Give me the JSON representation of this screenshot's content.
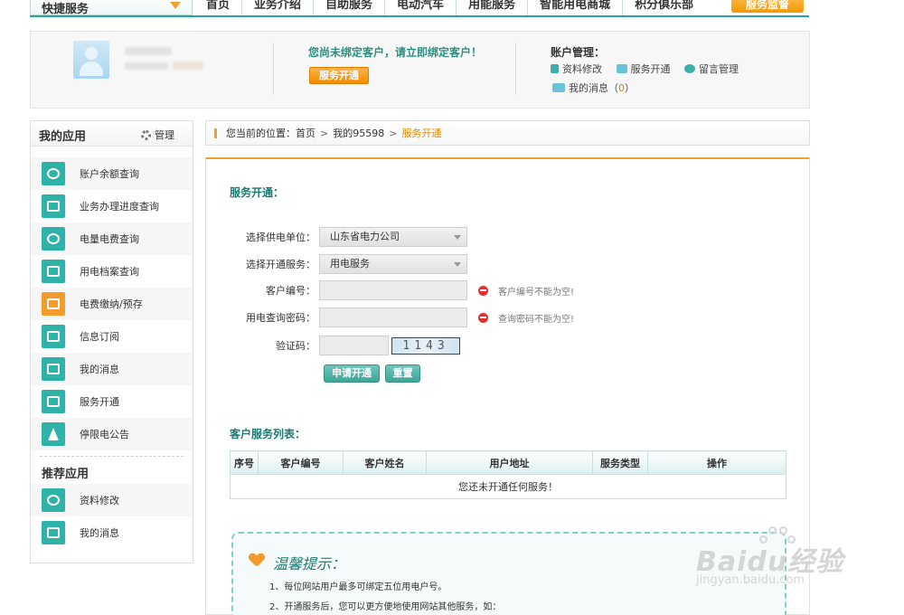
{
  "topnav": {
    "quick_label": "快捷服务",
    "items": [
      "首页",
      "业务介绍",
      "自助服务",
      "电动汽车",
      "用能服务",
      "智能用电商城",
      "积分俱乐部"
    ],
    "supervise_label": "服务监督"
  },
  "account": {
    "bind_message": "您尚未绑定客户，请立即绑定客户！",
    "bind_button": "服务开通",
    "manage_title": "账户管理：",
    "links": [
      "资料修改",
      "服务开通",
      "留言管理"
    ],
    "messages_label": "我的消息（",
    "messages_count": "0",
    "messages_close": "）"
  },
  "sidebar": {
    "title": "我的应用",
    "manage_label": "管理",
    "items": [
      "账户余额查询",
      "业务办理进度查询",
      "电量电费查询",
      "用电档案查询",
      "电费缴纳/预存",
      "信息订阅",
      "我的消息",
      "服务开通",
      "停限电公告"
    ],
    "recommend_title": "推荐应用",
    "recommend_items": [
      "资料修改",
      "我的消息"
    ]
  },
  "breadcrumb": {
    "prefix": "您当前的位置：",
    "home": "首页",
    "sep": ">",
    "mine": "我的95598",
    "current": "服务开通"
  },
  "form": {
    "title": "服务开通：",
    "supplier_label": "选择供电单位：",
    "supplier_value": "山东省电力公司",
    "service_label": "选择开通服务：",
    "service_value": "用电服务",
    "customer_no_label": "客户编号：",
    "customer_no_error": "客户编号不能为空!",
    "password_label": "用电查询密码：",
    "password_error": "查询密码不能为空!",
    "captcha_label": "验证码：",
    "captcha_text": "1143",
    "submit_label": "申请开通",
    "reset_label": "重置"
  },
  "service_list": {
    "title": "客户服务列表：",
    "columns": [
      "序号",
      "客户编号",
      "客户姓名",
      "用户地址",
      "服务类型",
      "操作"
    ],
    "empty_message": "您还未开通任何服务！"
  },
  "tips": {
    "title": "温馨提示：",
    "lines": [
      "1、每位网站用户最多可绑定五位用电户号。",
      "2、开通服务后，您可以更方便地使用网站其他服务，如："
    ]
  },
  "watermark": {
    "brand": "Baidu经验",
    "url": "jingyan.baidu.com"
  }
}
